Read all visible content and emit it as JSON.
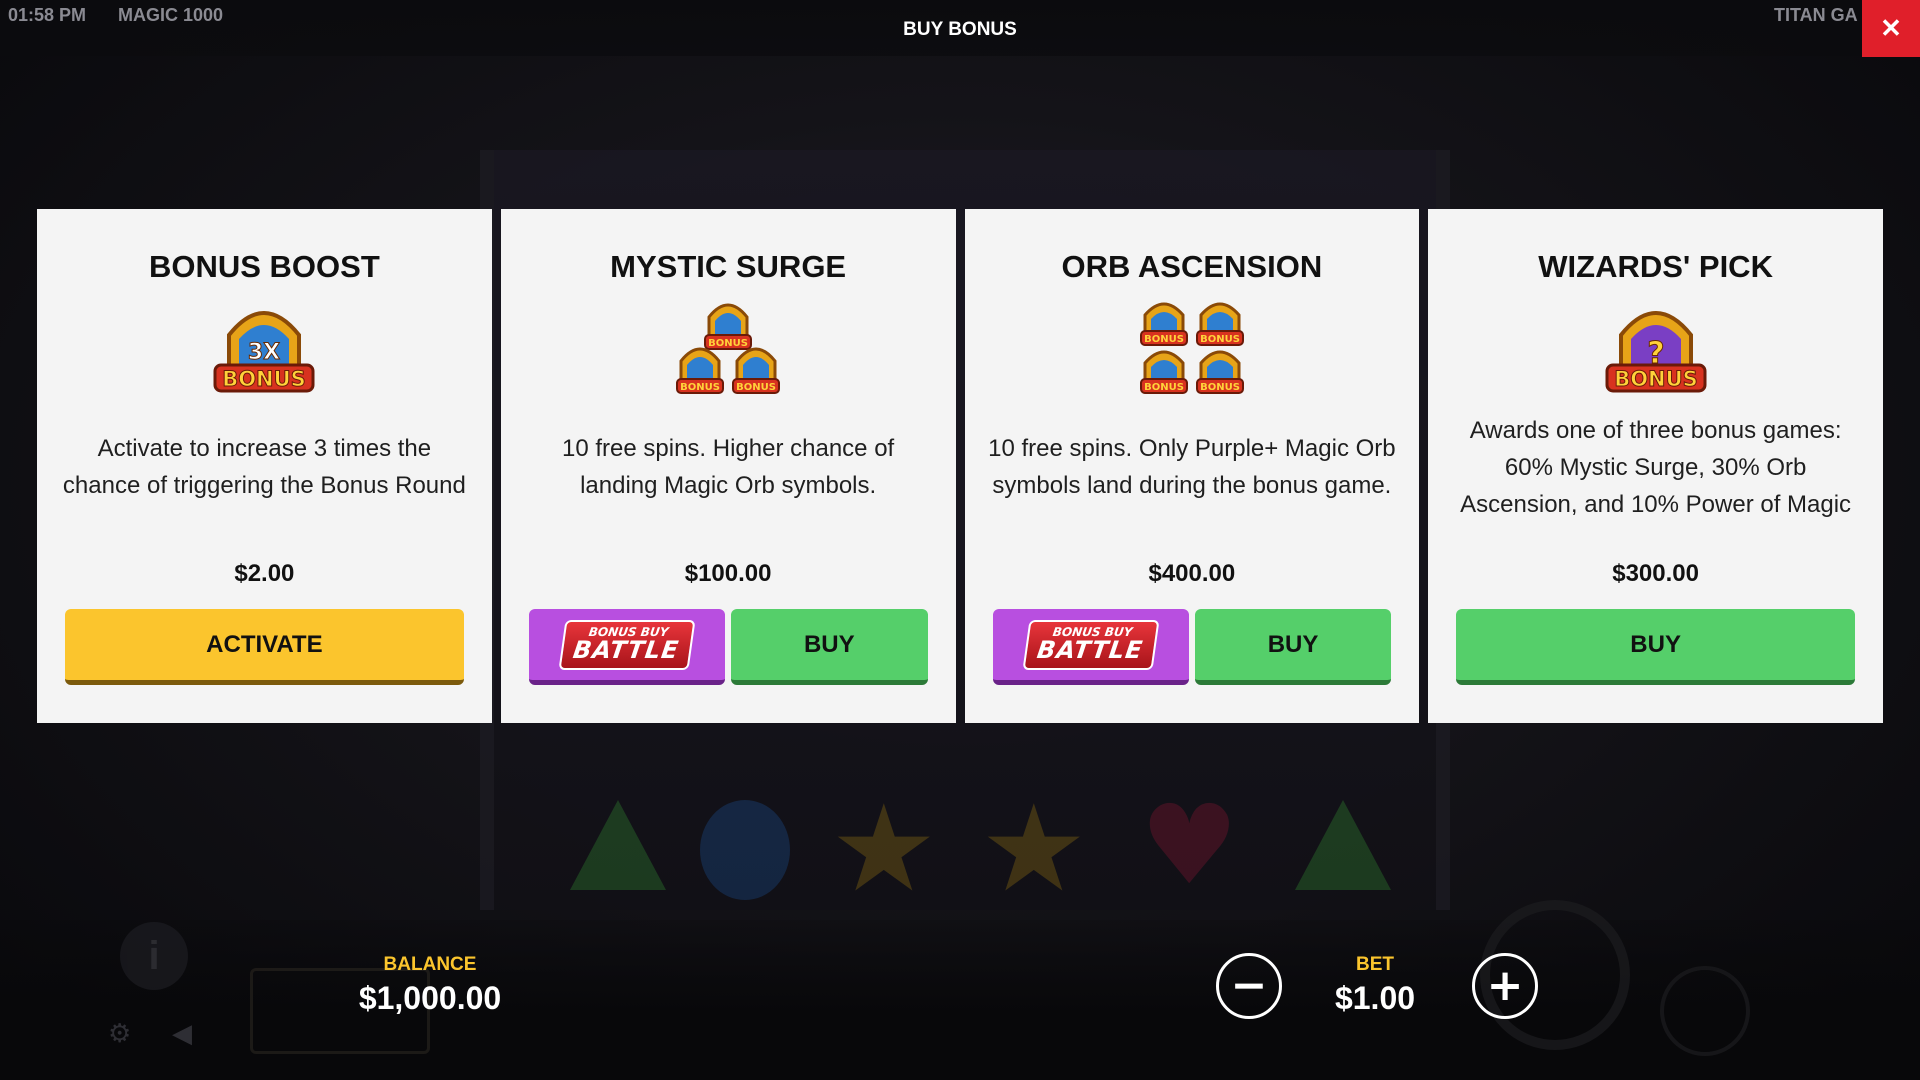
{
  "topbar": {
    "time": "01:58 PM",
    "game_name": "MAGIC 1000",
    "title": "BUY BONUS",
    "provider": "TITAN GA",
    "close_label": "✕"
  },
  "cards": [
    {
      "title": "BONUS BOOST",
      "icon": "bonus-3x-icon",
      "description": "Activate to increase 3 times the chance of triggering the Bonus Round",
      "price": "$2.00",
      "primary_label": "ACTIVATE",
      "has_battle": false
    },
    {
      "title": "MYSTIC SURGE",
      "icon": "bonus-triple-icon",
      "description": "10 free spins. Higher chance of landing Magic Orb symbols.",
      "price": "$100.00",
      "primary_label": "BUY",
      "has_battle": true
    },
    {
      "title": "ORB ASCENSION",
      "icon": "bonus-quad-icon",
      "description": "10 free spins. Only Purple+ Magic Orb symbols land during the bonus game.",
      "price": "$400.00",
      "primary_label": "BUY",
      "has_battle": true
    },
    {
      "title": "WIZARDS' PICK",
      "icon": "bonus-mystery-icon",
      "description": "Awards one of three bonus games: 60% Mystic Surge, 30% Orb Ascension, and 10% Power of Magic",
      "price": "$300.00",
      "primary_label": "BUY",
      "has_battle": false
    }
  ],
  "battle_logo": {
    "top": "BONUS BUY",
    "main": "BATTLE"
  },
  "icon_text": {
    "bonus": "BONUS",
    "multiplier": "3X",
    "mystery": "?"
  },
  "bottom": {
    "balance_label": "BALANCE",
    "balance_value": "$1,000.00",
    "bet_label": "BET",
    "bet_value": "$1.00",
    "minus_label": "−",
    "plus_label": "+"
  },
  "colors": {
    "accent_yellow": "#fbc52d",
    "buy_green": "#55cf6a",
    "battle_purple": "#b84fe0",
    "close_red": "#e01f2a"
  }
}
